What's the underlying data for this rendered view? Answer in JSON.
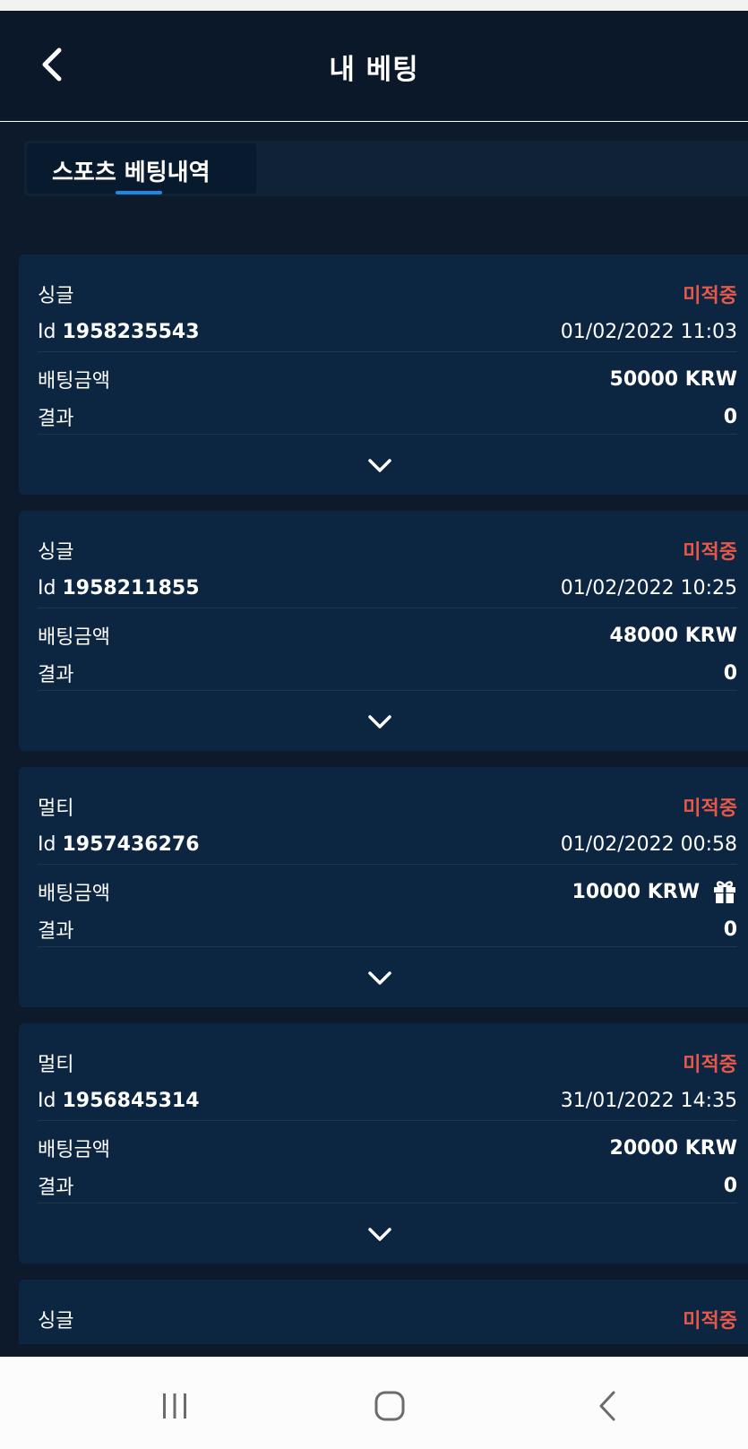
{
  "header": {
    "title": "내 베팅",
    "back_icon": "chevron-left-icon"
  },
  "tabs": [
    {
      "label": "스포츠 베팅내역",
      "active": true
    }
  ],
  "labels": {
    "id_prefix": "Id",
    "stake": "배팅금액",
    "result": "결과"
  },
  "bets": [
    {
      "type": "싱글",
      "status": "미적중",
      "id": "1958235543",
      "datetime": "01/02/2022 11:03",
      "stake": "50000 KRW",
      "result": "0",
      "bonus": false
    },
    {
      "type": "싱글",
      "status": "미적중",
      "id": "1958211855",
      "datetime": "01/02/2022 10:25",
      "stake": "48000 KRW",
      "result": "0",
      "bonus": false
    },
    {
      "type": "멀티",
      "status": "미적중",
      "id": "1957436276",
      "datetime": "01/02/2022 00:58",
      "stake": "10000 KRW",
      "result": "0",
      "bonus": true
    },
    {
      "type": "멀티",
      "status": "미적중",
      "id": "1956845314",
      "datetime": "31/01/2022 14:35",
      "stake": "20000 KRW",
      "result": "0",
      "bonus": false
    },
    {
      "type": "싱글",
      "status": "미적중"
    }
  ],
  "colors": {
    "background": "#0c1a2c",
    "card": "#0c2540",
    "status_lost": "#e6594a",
    "tab_indicator": "#1e88e5"
  },
  "system_nav": {
    "icons": [
      "recent-apps-icon",
      "home-icon",
      "back-icon"
    ]
  }
}
